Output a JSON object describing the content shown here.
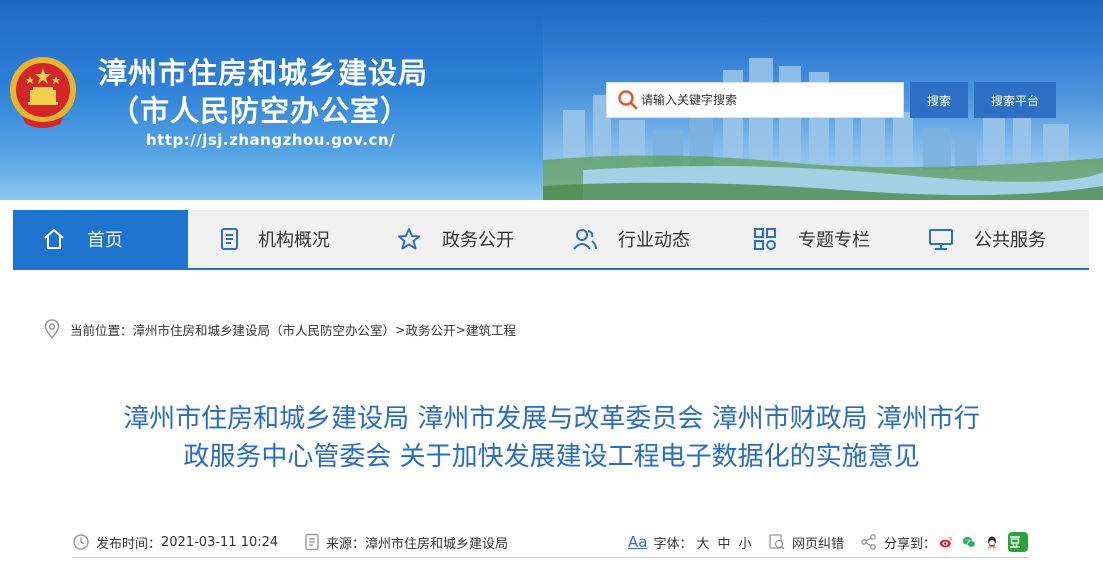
{
  "header": {
    "title": "漳州市住房和城乡建设局",
    "subtitle": "（市人民防空办公室）",
    "url": "http://jsj.zhangzhou.gov.cn/",
    "search_placeholder": "请输入关键字搜索",
    "search_button": "搜索",
    "platform_button": "搜索平台"
  },
  "nav": {
    "items": [
      {
        "label": "首页",
        "icon": "home-icon",
        "active": true
      },
      {
        "label": "机构概况",
        "icon": "document-icon"
      },
      {
        "label": "政务公开",
        "icon": "star-icon"
      },
      {
        "label": "行业动态",
        "icon": "users-icon"
      },
      {
        "label": "专题专栏",
        "icon": "grid-icon"
      },
      {
        "label": "公共服务",
        "icon": "monitor-icon"
      }
    ]
  },
  "breadcrumb": {
    "prefix": "当前位置：",
    "home": "漳州市住房和城乡建设局（市人民防空办公室）",
    "sep1": ">",
    "section": "政务公开",
    "sep2": ">",
    "current": "建筑工程"
  },
  "article": {
    "title_line1": "漳州市住房和城乡建设局 漳州市发展与改革委员会 漳州市财政局 漳州市行",
    "title_line2": "政服务中心管委会 关于加快发展建设工程电子数据化的实施意见"
  },
  "meta": {
    "date_label": "发布时间：",
    "date_value": "2021-03-11 10:24",
    "source_label": "来源：",
    "source_value": "漳州市住房和城乡建设局",
    "font_icon_text": "Aa",
    "font_label": "字体：",
    "font_large": "大",
    "font_medium": "中",
    "font_small": "小",
    "error_report": "网页纠错",
    "share_label": "分享到："
  },
  "colors": {
    "brand_blue": "#1e73cf",
    "title_blue": "#2a6cc4",
    "button_blue": "#2c6fc4"
  }
}
